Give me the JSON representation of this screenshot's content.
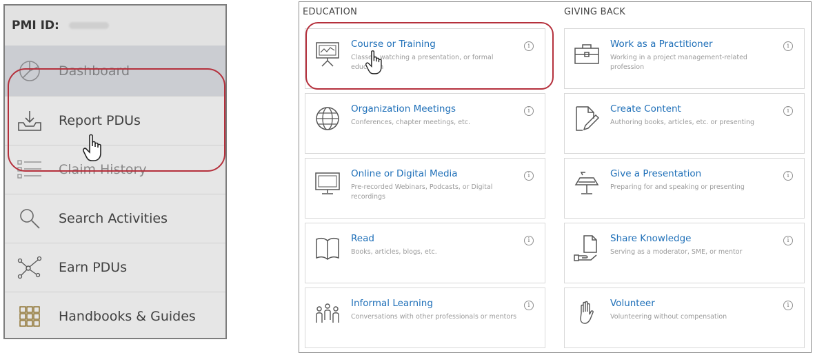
{
  "sidebar": {
    "pmi_label": "PMI ID:",
    "items": [
      {
        "label": "Dashboard",
        "icon": "dashboard-icon"
      },
      {
        "label": "Report PDUs",
        "icon": "report-pdus-icon"
      },
      {
        "label": "Claim History",
        "icon": "claim-history-icon"
      },
      {
        "label": "Search Activities",
        "icon": "search-icon"
      },
      {
        "label": "Earn PDUs",
        "icon": "earn-pdus-icon"
      },
      {
        "label": "Handbooks & Guides",
        "icon": "handbooks-icon"
      }
    ]
  },
  "education": {
    "title": "EDUCATION",
    "cards": [
      {
        "title": "Course or Training",
        "desc": "Classes, watching a presentation, or formal education",
        "icon": "presentation-board-icon"
      },
      {
        "title": "Organization Meetings",
        "desc": "Conferences, chapter meetings, etc.",
        "icon": "globe-icon"
      },
      {
        "title": "Online or Digital Media",
        "desc": "Pre-recorded Webinars, Podcasts, or Digital recordings",
        "icon": "monitor-icon"
      },
      {
        "title": "Read",
        "desc": "Books, articles, blogs, etc.",
        "icon": "open-book-icon"
      },
      {
        "title": "Informal Learning",
        "desc": "Conversations with other professionals or mentors",
        "icon": "people-icon"
      }
    ]
  },
  "giving_back": {
    "title": "GIVING BACK",
    "cards": [
      {
        "title": "Work as a Practitioner",
        "desc": "Working in a project management-related profession",
        "icon": "briefcase-icon"
      },
      {
        "title": "Create Content",
        "desc": "Authoring books, articles, etc. or presenting",
        "icon": "document-pen-icon"
      },
      {
        "title": "Give a Presentation",
        "desc": "Preparing for and speaking or presenting",
        "icon": "podium-icon"
      },
      {
        "title": "Share Knowledge",
        "desc": "Serving as a moderator, SME, or mentor",
        "icon": "hand-document-icon"
      },
      {
        "title": "Volunteer",
        "desc": "Volunteering without compensation",
        "icon": "raised-hand-icon"
      }
    ]
  },
  "info_glyph": "i",
  "colors": {
    "link": "#1e6fb8",
    "highlight": "#b5303c",
    "sidebar_bg": "#e6e6e6"
  }
}
